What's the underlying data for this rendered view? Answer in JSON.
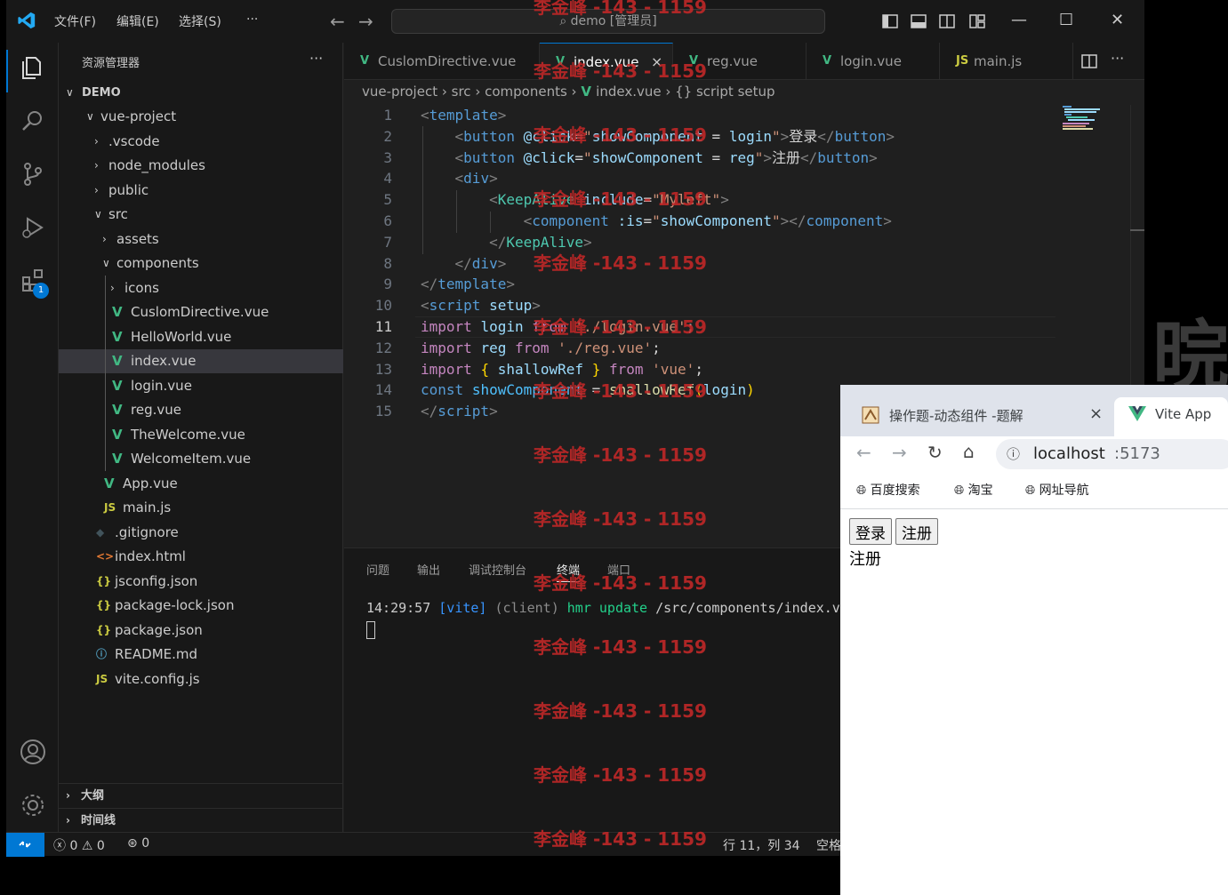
{
  "titlebar": {
    "menus": [
      "文件(F)",
      "编辑(E)",
      "选择(S)",
      "···"
    ],
    "search": "demo [管理员]"
  },
  "activity": {
    "extensions_badge": "1"
  },
  "sidebar": {
    "title": "资源管理器",
    "more": "···",
    "root": "DEMO",
    "items": [
      {
        "label": "vue-project",
        "indent": 1,
        "type": "folder-open",
        "icon": ""
      },
      {
        "label": ".vscode",
        "indent": 2,
        "type": "folder",
        "icon": ""
      },
      {
        "label": "node_modules",
        "indent": 2,
        "type": "folder",
        "icon": ""
      },
      {
        "label": "public",
        "indent": 2,
        "type": "folder",
        "icon": ""
      },
      {
        "label": "src",
        "indent": 2,
        "type": "folder-open",
        "icon": ""
      },
      {
        "label": "assets",
        "indent": 3,
        "type": "folder",
        "icon": ""
      },
      {
        "label": "components",
        "indent": 3,
        "type": "folder-open",
        "icon": ""
      },
      {
        "label": "icons",
        "indent": 4,
        "type": "folder",
        "icon": ""
      },
      {
        "label": "CuslomDirective.vue",
        "indent": 4,
        "type": "vue",
        "icon": "V"
      },
      {
        "label": "HelloWorld.vue",
        "indent": 4,
        "type": "vue",
        "icon": "V"
      },
      {
        "label": "index.vue",
        "indent": 4,
        "type": "vue",
        "icon": "V",
        "selected": true
      },
      {
        "label": "login.vue",
        "indent": 4,
        "type": "vue",
        "icon": "V"
      },
      {
        "label": "reg.vue",
        "indent": 4,
        "type": "vue",
        "icon": "V"
      },
      {
        "label": "TheWelcome.vue",
        "indent": 4,
        "type": "vue",
        "icon": "V"
      },
      {
        "label": "WelcomeItem.vue",
        "indent": 4,
        "type": "vue",
        "icon": "V"
      },
      {
        "label": "App.vue",
        "indent": 3,
        "type": "vue",
        "icon": "V"
      },
      {
        "label": "main.js",
        "indent": 3,
        "type": "js",
        "icon": "JS"
      },
      {
        "label": ".gitignore",
        "indent": 2,
        "type": "git",
        "icon": "◆"
      },
      {
        "label": "index.html",
        "indent": 2,
        "type": "html",
        "icon": "<>"
      },
      {
        "label": "jsconfig.json",
        "indent": 2,
        "type": "json",
        "icon": "{}"
      },
      {
        "label": "package-lock.json",
        "indent": 2,
        "type": "json",
        "icon": "{}"
      },
      {
        "label": "package.json",
        "indent": 2,
        "type": "json",
        "icon": "{}"
      },
      {
        "label": "README.md",
        "indent": 2,
        "type": "info",
        "icon": "ⓘ"
      },
      {
        "label": "vite.config.js",
        "indent": 2,
        "type": "js",
        "icon": "JS"
      }
    ],
    "outline": "大纲",
    "timeline": "时间线"
  },
  "tabs": [
    {
      "label": "CuslomDirective.vue",
      "icon": "V",
      "type": "vue"
    },
    {
      "label": "index.vue",
      "icon": "V",
      "type": "vue",
      "active": true,
      "close": "×"
    },
    {
      "label": "reg.vue",
      "icon": "V",
      "type": "vue"
    },
    {
      "label": "login.vue",
      "icon": "V",
      "type": "vue"
    },
    {
      "label": "main.js",
      "icon": "JS",
      "type": "js"
    }
  ],
  "breadcrumb": [
    "vue-project",
    "src",
    "components",
    "index.vue",
    "{} script setup"
  ],
  "code": {
    "current_line": 11,
    "lines": [
      [
        [
          "<",
          "#808080"
        ],
        [
          "template",
          "#569cd6"
        ],
        [
          ">",
          "#808080"
        ]
      ],
      [
        [
          "    ",
          ""
        ],
        [
          "<",
          "#808080"
        ],
        [
          "button",
          "#569cd6"
        ],
        [
          " ",
          ""
        ],
        [
          "@click",
          "#9cdcfe"
        ],
        [
          "=",
          "#d4d4d4"
        ],
        [
          "\"",
          "#ce9178"
        ],
        [
          "showComponent",
          "#9cdcfe"
        ],
        [
          " = ",
          "#d4d4d4"
        ],
        [
          "login",
          "#9cdcfe"
        ],
        [
          "\"",
          "#ce9178"
        ],
        [
          ">",
          "#808080"
        ],
        [
          "登录",
          "#d4d4d4"
        ],
        [
          "</",
          "#808080"
        ],
        [
          "button",
          "#569cd6"
        ],
        [
          ">",
          "#808080"
        ]
      ],
      [
        [
          "    ",
          ""
        ],
        [
          "<",
          "#808080"
        ],
        [
          "button",
          "#569cd6"
        ],
        [
          " ",
          ""
        ],
        [
          "@click",
          "#9cdcfe"
        ],
        [
          "=",
          "#d4d4d4"
        ],
        [
          "\"",
          "#ce9178"
        ],
        [
          "showComponent",
          "#9cdcfe"
        ],
        [
          " = ",
          "#d4d4d4"
        ],
        [
          "reg",
          "#9cdcfe"
        ],
        [
          "\"",
          "#ce9178"
        ],
        [
          ">",
          "#808080"
        ],
        [
          "注册",
          "#d4d4d4"
        ],
        [
          "</",
          "#808080"
        ],
        [
          "button",
          "#569cd6"
        ],
        [
          ">",
          "#808080"
        ]
      ],
      [
        [
          "    ",
          ""
        ],
        [
          "<",
          "#808080"
        ],
        [
          "div",
          "#569cd6"
        ],
        [
          ">",
          "#808080"
        ]
      ],
      [
        [
          "        ",
          ""
        ],
        [
          "<",
          "#808080"
        ],
        [
          "KeepAlive",
          "#4ec9b0"
        ],
        [
          " ",
          ""
        ],
        [
          "include",
          "#9cdcfe"
        ],
        [
          "=",
          "#d4d4d4"
        ],
        [
          "\"Myleft\"",
          "#ce9178"
        ],
        [
          ">",
          "#808080"
        ]
      ],
      [
        [
          "            ",
          ""
        ],
        [
          "<",
          "#808080"
        ],
        [
          "component",
          "#569cd6"
        ],
        [
          " ",
          ""
        ],
        [
          ":is",
          "#9cdcfe"
        ],
        [
          "=",
          "#d4d4d4"
        ],
        [
          "\"",
          "#ce9178"
        ],
        [
          "showComponent",
          "#9cdcfe"
        ],
        [
          "\"",
          "#ce9178"
        ],
        [
          "></",
          "#808080"
        ],
        [
          "component",
          "#569cd6"
        ],
        [
          ">",
          "#808080"
        ]
      ],
      [
        [
          "        ",
          ""
        ],
        [
          "</",
          "#808080"
        ],
        [
          "KeepAlive",
          "#4ec9b0"
        ],
        [
          ">",
          "#808080"
        ]
      ],
      [
        [
          "    ",
          ""
        ],
        [
          "</",
          "#808080"
        ],
        [
          "div",
          "#569cd6"
        ],
        [
          ">",
          "#808080"
        ]
      ],
      [
        [
          "</",
          "#808080"
        ],
        [
          "template",
          "#569cd6"
        ],
        [
          ">",
          "#808080"
        ]
      ],
      [
        [
          "<",
          "#808080"
        ],
        [
          "script",
          "#569cd6"
        ],
        [
          " ",
          ""
        ],
        [
          "setup",
          "#9cdcfe"
        ],
        [
          ">",
          "#808080"
        ]
      ],
      [
        [
          "import",
          "#c586c0"
        ],
        [
          " ",
          ""
        ],
        [
          "login",
          "#9cdcfe"
        ],
        [
          " ",
          ""
        ],
        [
          "from",
          "#c586c0"
        ],
        [
          " ",
          ""
        ],
        [
          "'./login.vue'",
          "#ce9178"
        ],
        [
          ";",
          "#d4d4d4"
        ]
      ],
      [
        [
          "import",
          "#c586c0"
        ],
        [
          " ",
          ""
        ],
        [
          "reg",
          "#9cdcfe"
        ],
        [
          " ",
          ""
        ],
        [
          "from",
          "#c586c0"
        ],
        [
          " ",
          ""
        ],
        [
          "'./reg.vue'",
          "#ce9178"
        ],
        [
          ";",
          "#d4d4d4"
        ]
      ],
      [
        [
          "import",
          "#c586c0"
        ],
        [
          " ",
          ""
        ],
        [
          "{",
          "#ffd700"
        ],
        [
          " ",
          ""
        ],
        [
          "shallowRef",
          "#9cdcfe"
        ],
        [
          " ",
          ""
        ],
        [
          "}",
          "#ffd700"
        ],
        [
          " ",
          ""
        ],
        [
          "from",
          "#c586c0"
        ],
        [
          " ",
          ""
        ],
        [
          "'vue'",
          "#ce9178"
        ],
        [
          ";",
          "#d4d4d4"
        ]
      ],
      [
        [
          "const",
          "#569cd6"
        ],
        [
          " ",
          ""
        ],
        [
          "showComponent",
          "#4fc1ff"
        ],
        [
          " = ",
          "#d4d4d4"
        ],
        [
          "shallowRef",
          "#dcdcaa"
        ],
        [
          "(",
          "#ffd700"
        ],
        [
          "login",
          "#9cdcfe"
        ],
        [
          ")",
          "#ffd700"
        ]
      ],
      [
        [
          "</",
          "#808080"
        ],
        [
          "script",
          "#569cd6"
        ],
        [
          ">",
          "#808080"
        ]
      ]
    ]
  },
  "panel": {
    "tabs": [
      "问题",
      "输出",
      "调试控制台",
      "终端",
      "端口"
    ],
    "active_tab": "终端",
    "terminal": [
      [
        "14:29:57 ",
        "#cccccc"
      ],
      [
        "[vite]",
        "#3794ff"
      ],
      [
        " (client) ",
        "#8b8b8b"
      ],
      [
        "hmr update ",
        "#23d18b"
      ],
      [
        "/src/components/index.v",
        "#cccccc"
      ]
    ]
  },
  "statusbar": {
    "errors": "0",
    "warnings": "0",
    "ports": "0",
    "position": "行 11，列 34",
    "spaces": "空格"
  },
  "watermark": "李金峰 -143 - 1159",
  "background_glyph": "晥",
  "browser": {
    "tabs": [
      {
        "label": "操作题-动态组件 -题解",
        "close": "×"
      },
      {
        "label": "Vite App",
        "active": true
      }
    ],
    "url_host": "localhost",
    "url_port": ":5173",
    "bookmarks": [
      "百度搜索",
      "淘宝",
      "网址导航"
    ],
    "page": {
      "buttons": [
        "登录",
        "注册"
      ],
      "text": "注册"
    }
  },
  "colors": {
    "accent": "#0078d4",
    "vue_green": "#41b883",
    "js_yellow": "#cbcb41",
    "json_yellow": "#cbcb41",
    "html_orange": "#e37933",
    "watermark_red": "#c42828"
  }
}
